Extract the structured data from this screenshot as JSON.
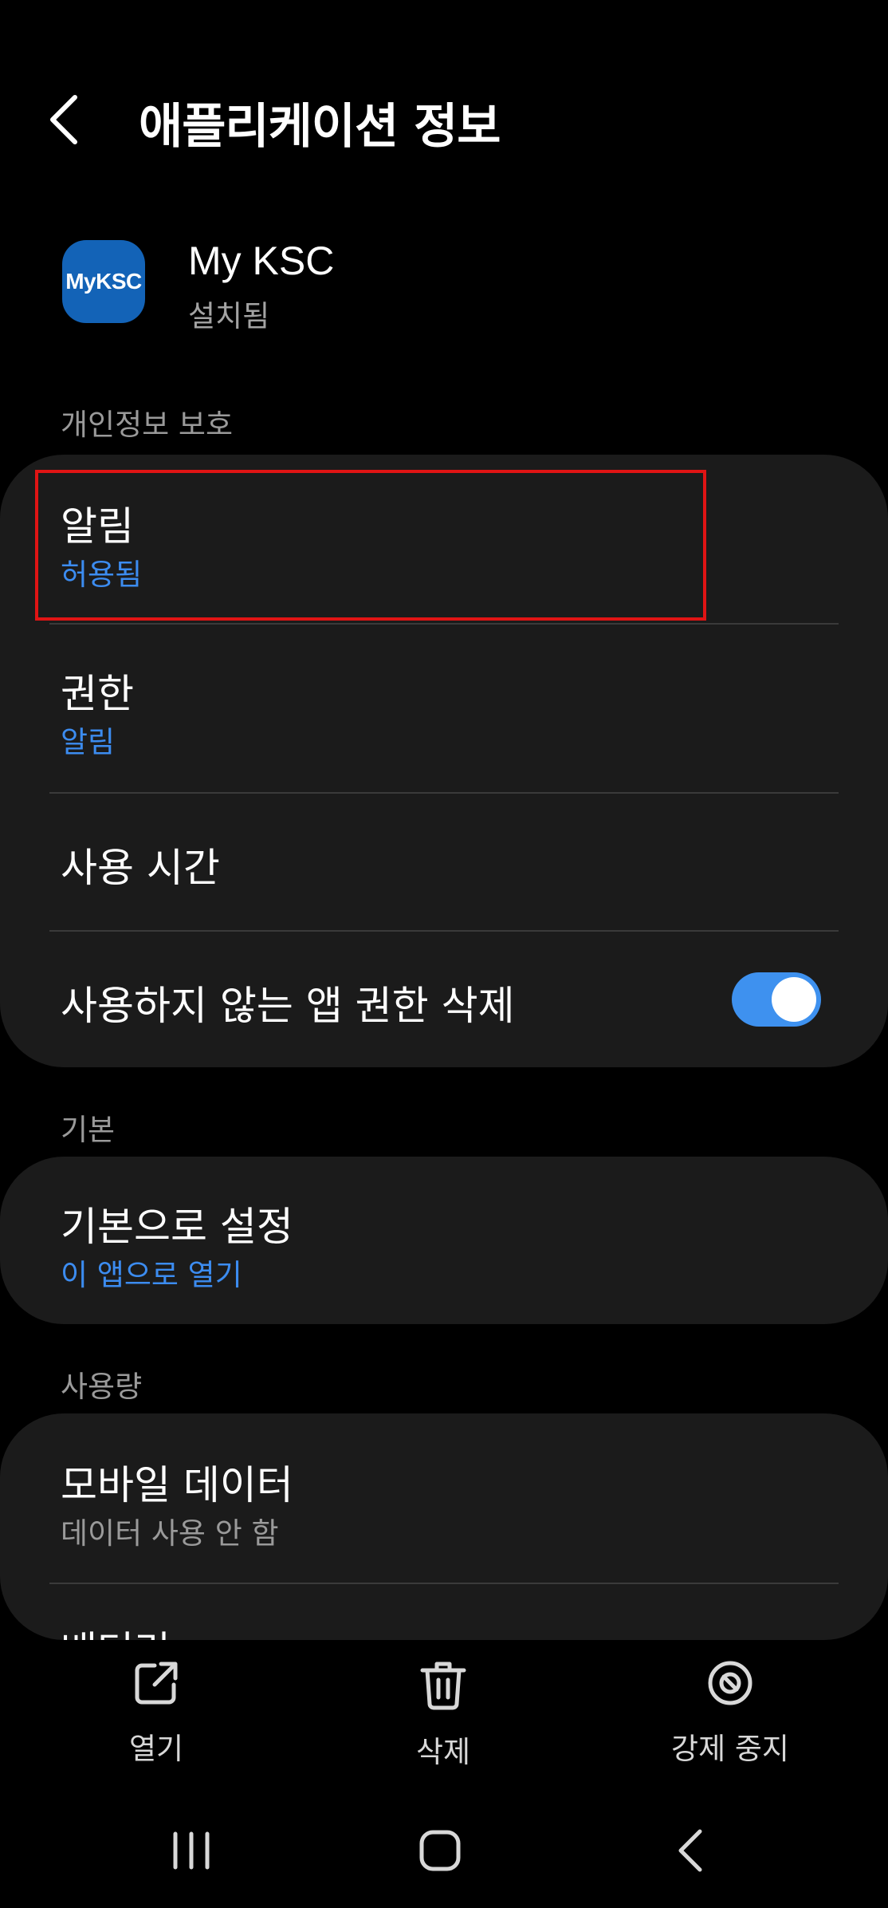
{
  "header": {
    "title": "애플리케이션 정보",
    "back_icon": "chevron-left-icon"
  },
  "app": {
    "icon_text": "MyKSC",
    "name": "My KSC",
    "status": "설치됨"
  },
  "sections": {
    "privacy": {
      "label": "개인정보 보호",
      "notifications": {
        "title": "알림",
        "value": "허용됨"
      },
      "permissions": {
        "title": "권한",
        "value": "알림"
      },
      "screen_time": {
        "title": "사용 시간"
      },
      "remove_permissions": {
        "title": "사용하지 않는 앱 권한 삭제",
        "toggle_on": true
      }
    },
    "defaults": {
      "label": "기본",
      "set_default": {
        "title": "기본으로 설정",
        "value": "이 앱으로 열기"
      }
    },
    "usage": {
      "label": "사용량",
      "mobile_data": {
        "title": "모바일 데이터",
        "value": "데이터 사용 안 함"
      },
      "battery": {
        "title": "배터리"
      }
    }
  },
  "actions": {
    "open": {
      "label": "열기",
      "icon": "open-external-icon"
    },
    "delete": {
      "label": "삭제",
      "icon": "trash-icon"
    },
    "force_stop": {
      "label": "강제 중지",
      "icon": "block-icon"
    }
  },
  "nav": {
    "recents": "recents-icon",
    "home": "home-icon",
    "back": "back-icon"
  },
  "colors": {
    "accent": "#3c8cf0",
    "app_icon_bg": "#1363b7",
    "highlight": "#e01414",
    "card_bg": "#1b1b1b"
  }
}
